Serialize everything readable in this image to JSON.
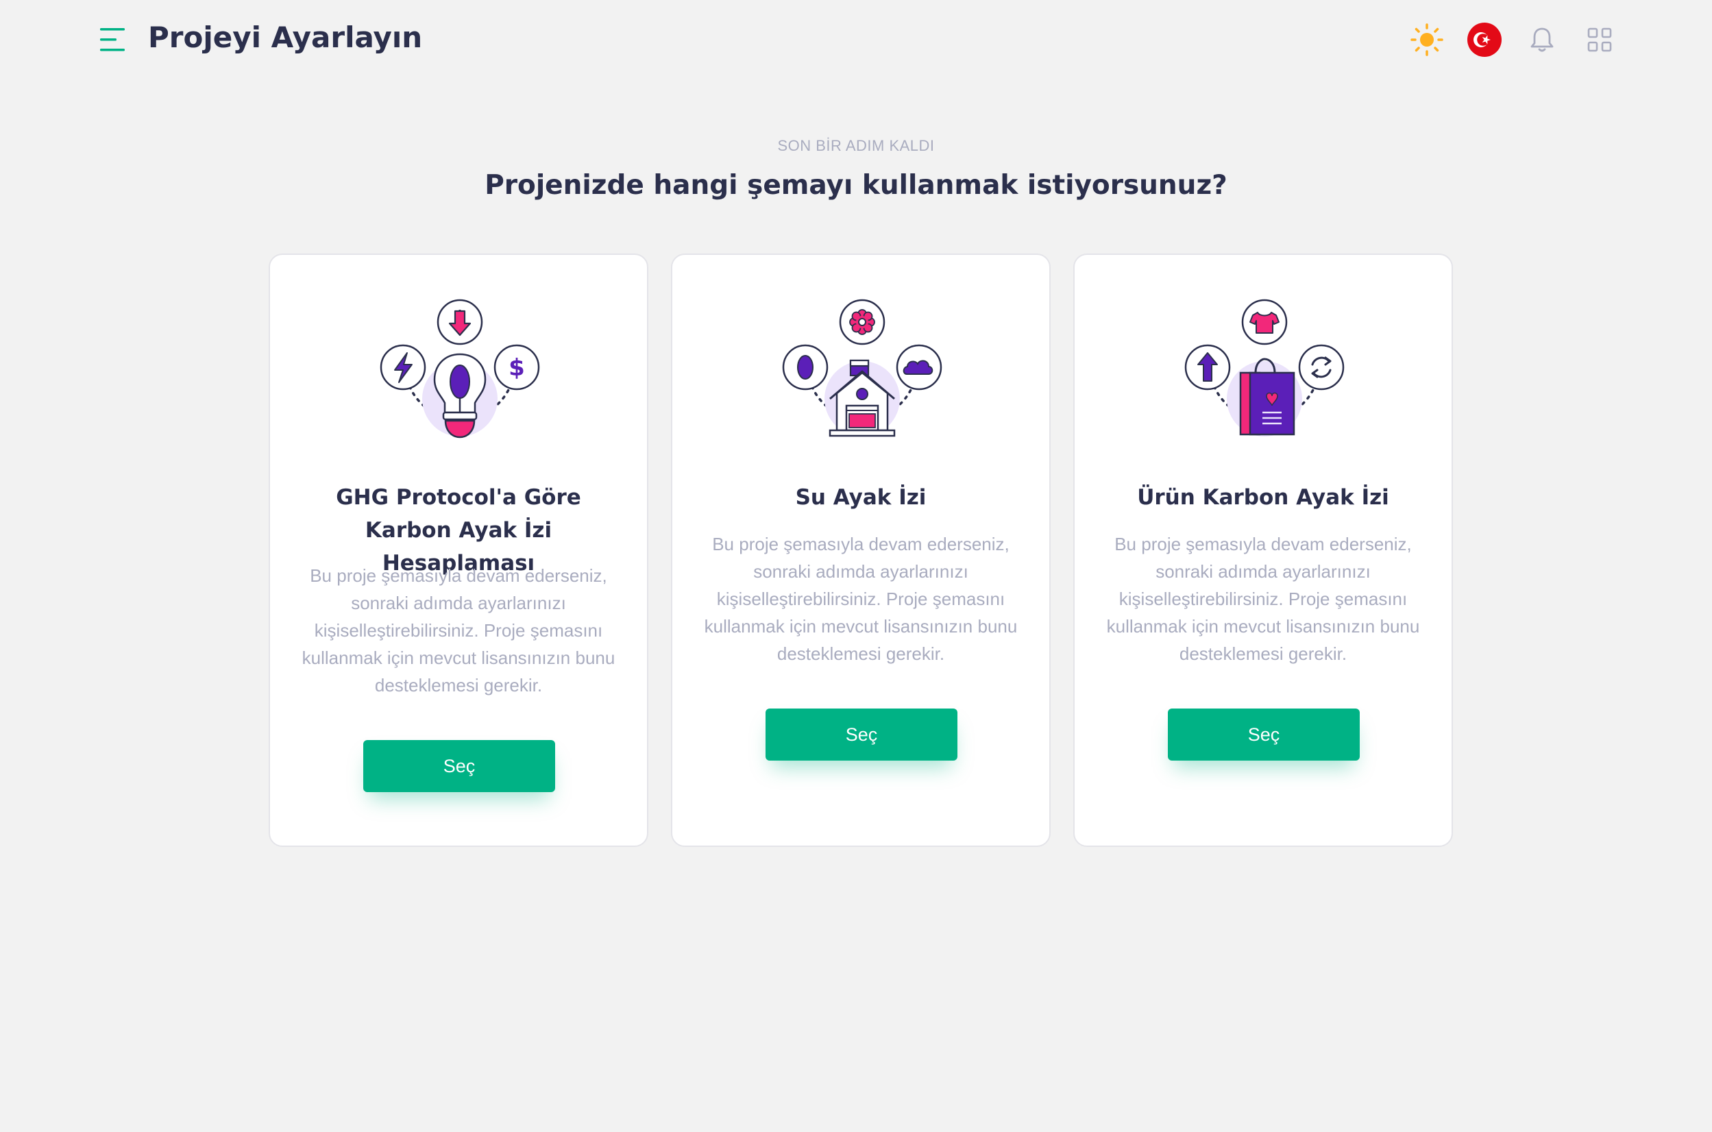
{
  "header": {
    "title": "Projeyi Ayarlayın",
    "icons": [
      "menu-icon",
      "sun-icon",
      "turkey-flag-icon",
      "bell-icon",
      "apps-grid-icon"
    ]
  },
  "intro": {
    "eyebrow": "SON BİR ADIM KALDI",
    "question": "Projenizde hangi şemayı kullanmak istiyorsunuz?"
  },
  "cards": [
    {
      "title": "GHG Protocol'a Göre Karbon Ayak İzi Hesaplaması",
      "description": "Bu proje şemasıyla devam ederseniz, sonraki adımda ayarlarınızı kişiselleştirebilirsiniz. Proje şemasını kullanmak için mevcut lisansınızın bunu desteklemesi gerekir.",
      "button": "Seç",
      "illustration": "energy-bulb-illustration"
    },
    {
      "title": "Su Ayak İzi",
      "description": "Bu proje şemasıyla devam ederseniz, sonraki adımda ayarlarınızı kişiselleştirebilirsiniz. Proje şemasını kullanmak için mevcut lisansınızın bunu desteklemesi gerekir.",
      "button": "Seç",
      "illustration": "house-illustration"
    },
    {
      "title": "Ürün Karbon Ayak İzi",
      "description": "Bu proje şemasıyla devam ederseniz, sonraki adımda ayarlarınızı kişiselleştirebilirsiniz. Proje şemasını kullanmak için mevcut lisansınızın bunu desteklemesi gerekir.",
      "button": "Seç",
      "illustration": "shopping-bag-illustration"
    }
  ],
  "colors": {
    "background": "#f2f2f2",
    "accent": "#00b285",
    "text_dark": "#2b2f4c",
    "text_muted": "#a9acbf",
    "illustration_purple": "#5b1fb8",
    "illustration_pink": "#f2287a",
    "illustration_lavender": "#ebe3fb"
  }
}
